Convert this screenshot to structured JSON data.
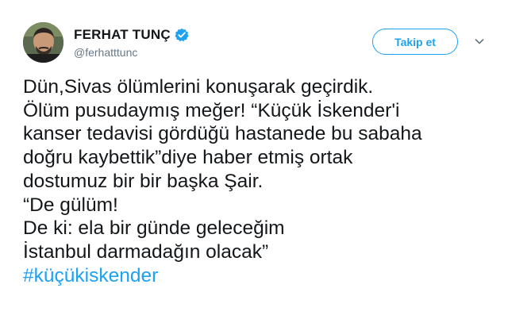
{
  "user": {
    "display_name": "FERHAT TUNÇ",
    "handle": "@ferhatttunc"
  },
  "actions": {
    "follow_label": "Takip et"
  },
  "tweet": {
    "lines": [
      "Dün,Sivas ölümlerini konuşarak geçirdik.",
      "Ölüm pusudaymış meğer! “Küçük İskender'i",
      "kanser tedavisi gördüğü hastanede bu sabaha",
      "doğru kaybettik”diye haber etmiş ortak",
      "dostumuz bir bir başka Şair.",
      "“De gülüm!",
      "De ki: ela bir günde geleceğim",
      "İstanbul darmadağın olacak”"
    ],
    "hashtag": "#küçükiskender"
  },
  "icons": {
    "verified": "verified-badge-icon",
    "caret": "chevron-down-icon"
  },
  "colors": {
    "accent": "#1da1f2",
    "text": "#14171a",
    "muted": "#657786"
  }
}
